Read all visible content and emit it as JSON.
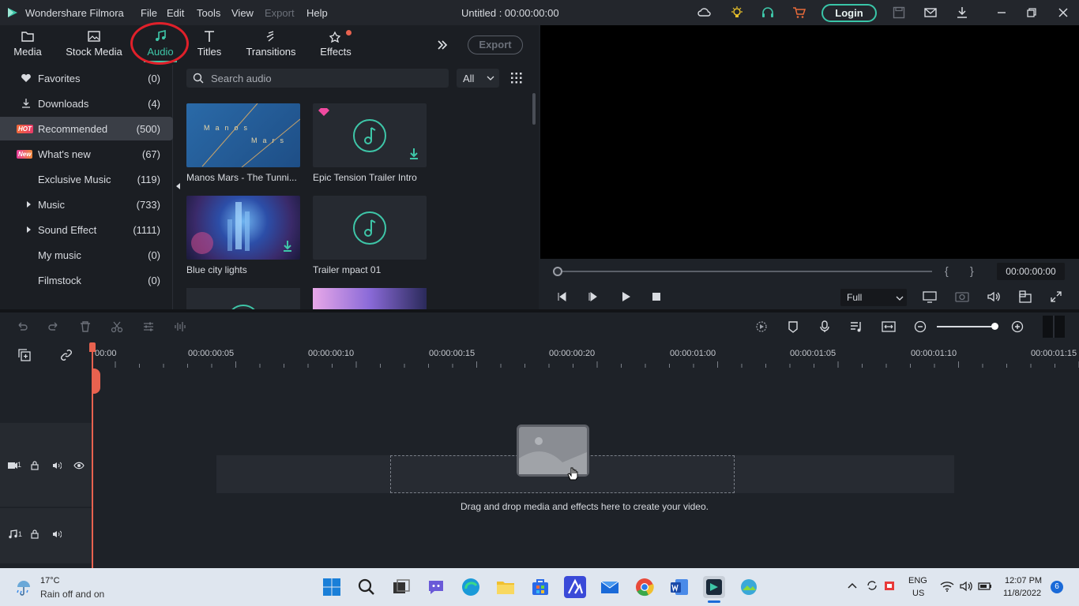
{
  "app": {
    "name": "Wondershare Filmora",
    "document_title": "Untitled : 00:00:00:00",
    "login_label": "Login"
  },
  "menu": [
    "File",
    "Edit",
    "Tools",
    "View",
    "Export",
    "Help"
  ],
  "tabs": [
    {
      "label": "Media",
      "icon": "folder-icon"
    },
    {
      "label": "Stock Media",
      "icon": "image-icon"
    },
    {
      "label": "Audio",
      "icon": "music-note-icon"
    },
    {
      "label": "Titles",
      "icon": "text-icon"
    },
    {
      "label": "Transitions",
      "icon": "transition-icon"
    },
    {
      "label": "Effects",
      "icon": "sparkle-icon"
    }
  ],
  "export_label": "Export",
  "sidebar": [
    {
      "label": "Favorites",
      "count": "(0)",
      "icon": "heart-icon"
    },
    {
      "label": "Downloads",
      "count": "(4)",
      "icon": "download-icon"
    },
    {
      "label": "Recommended",
      "count": "(500)",
      "badge": "HOT"
    },
    {
      "label": "What's new",
      "count": "(67)",
      "badge": "New"
    },
    {
      "label": "Exclusive Music",
      "count": "(119)"
    },
    {
      "label": "Music",
      "count": "(733)",
      "expandable": true
    },
    {
      "label": "Sound Effect",
      "count": "(1111)",
      "expandable": true
    },
    {
      "label": "My music",
      "count": "(0)"
    },
    {
      "label": "Filmstock",
      "count": "(0)"
    }
  ],
  "search": {
    "placeholder": "Search audio",
    "filter": "All"
  },
  "media_items": [
    {
      "name": "Manos Mars - The Tunni...",
      "thumb_text_1": "Manos",
      "thumb_text_2": "Mars"
    },
    {
      "name": "Epic Tension Trailer Intro"
    },
    {
      "name": "Blue city lights"
    },
    {
      "name": "Trailer mpact 01"
    }
  ],
  "preview": {
    "timecode": "00:00:00:00",
    "quality": "Full",
    "marker_in": "{",
    "marker_out": "}"
  },
  "timeline": {
    "ruler": [
      "00:00",
      "00:00:00:05",
      "00:00:00:10",
      "00:00:00:15",
      "00:00:00:20",
      "00:00:01:00",
      "00:00:01:05",
      "00:00:01:10",
      "00:00:01:15"
    ],
    "video_track": "1",
    "audio_track": "1",
    "drop_hint": "Drag and drop media and effects here to create your video."
  },
  "taskbar": {
    "weather_temp": "17°C",
    "weather_desc": "Rain off and on",
    "lang_1": "ENG",
    "lang_2": "US",
    "time": "12:07 PM",
    "date": "11/8/2022",
    "notifications": "6"
  },
  "colors": {
    "accent": "#3ec6a8",
    "annotation": "#e0202a",
    "playhead": "#e8624f"
  }
}
